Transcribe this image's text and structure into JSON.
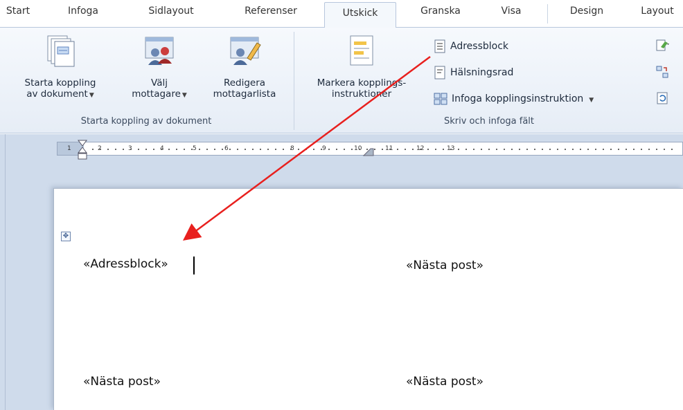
{
  "tabs": [
    "Start",
    "Infoga",
    "Sidlayout",
    "Referenser",
    "Utskick",
    "Granska",
    "Visa",
    "Design",
    "Layout"
  ],
  "active_tab": "Utskick",
  "ribbon": {
    "group1": {
      "label": "Starta koppling av dokument",
      "start_btn": {
        "line1": "Starta koppling",
        "line2": "av dokument"
      },
      "select_btn": {
        "line1": "Välj",
        "line2": "mottagare"
      },
      "edit_btn": {
        "line1": "Redigera",
        "line2": "mottagarlista"
      }
    },
    "group2": {
      "label": "Skriv och infoga fält",
      "mark_btn": {
        "line1": "Markera kopplings-",
        "line2": "instruktioner"
      },
      "address_block": "Adressblock",
      "greeting_line": "Hälsningsrad",
      "insert_field": "Infoga kopplingsinstruktion"
    }
  },
  "ruler": {
    "numbers": [
      "1",
      "2",
      "3",
      "4",
      "5",
      "6",
      "8",
      "9",
      "10",
      "11",
      "12",
      "13"
    ]
  },
  "document": {
    "cell1": "«Adressblock»",
    "cell2": "«Nästa post»",
    "cell3": "«Nästa post»",
    "cell4": "«Nästa post»"
  },
  "colors": {
    "arrow": "#e8201e",
    "ribbon_bg": "#e6edf6",
    "workspace_bg": "#cfdbeb"
  }
}
